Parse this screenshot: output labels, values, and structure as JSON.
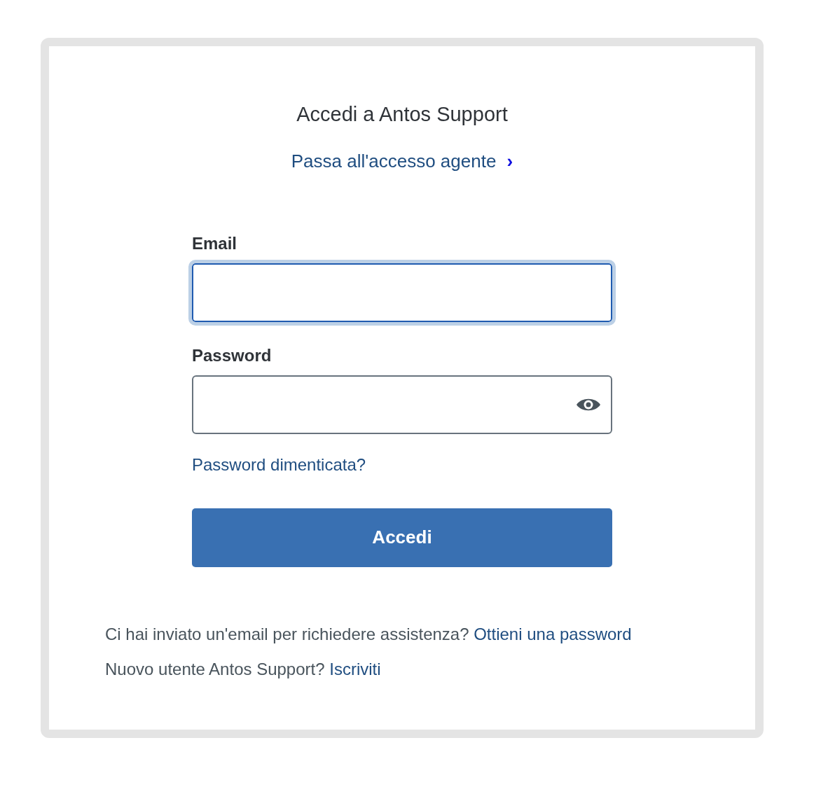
{
  "title": "Accedi a Antos Support",
  "agent_link": {
    "label": "Passa all'accesso agente",
    "chevron": "›"
  },
  "fields": [
    {
      "label": "Email",
      "kind": "email",
      "focused": true
    },
    {
      "label": "Password",
      "kind": "password",
      "focused": false
    }
  ],
  "forgot_link": "Password dimenticata?",
  "submit": "Accedi",
  "footer": [
    {
      "text": "Ci hai inviato un'email per richiedere assistenza?",
      "link": "Ottieni una password"
    },
    {
      "text": "Nuovo utente Antos Support?",
      "link": "Iscriviti"
    }
  ]
}
